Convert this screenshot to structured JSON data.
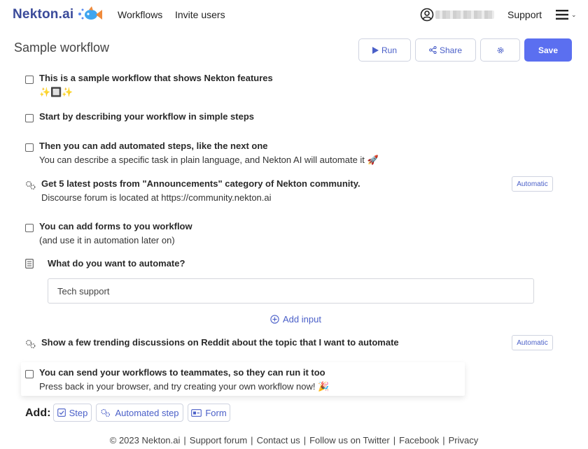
{
  "header": {
    "logo_text": "Nekton.ai",
    "nav": [
      "Workflows",
      "Invite users"
    ],
    "support": "Support"
  },
  "page": {
    "title": "Sample workflow"
  },
  "toolbar": {
    "run": "Run",
    "share": "Share",
    "save": "Save"
  },
  "steps": [
    {
      "type": "manual",
      "title": "This is a sample workflow that shows Nekton features",
      "sub": "✨🔲✨"
    },
    {
      "type": "manual",
      "title": "Start by describing your workflow in simple steps",
      "sub": ""
    },
    {
      "type": "manual",
      "title": "Then you can add automated steps, like the next one",
      "sub": "You can describe a specific task in plain language, and Nekton AI will automate it 🚀"
    },
    {
      "type": "automated",
      "title": "Get 5 latest posts from \"Announcements\" category of Nekton community.",
      "sub": "Discourse forum is located at https://community.nekton.ai",
      "badge": "Automatic"
    },
    {
      "type": "manual",
      "title": "You can add forms to you workflow",
      "sub": "(and use it in automation later on)"
    },
    {
      "type": "automated",
      "title": "Show a few trending discussions on Reddit about the topic that I want to automate",
      "sub": "",
      "badge": "Automatic"
    },
    {
      "type": "manual",
      "title": "You can send your workflows to teammates, so they can run it too",
      "sub": "Press back in your browser, and try creating your own workflow now! 🎉"
    }
  ],
  "form": {
    "question": "What do you want to automate?",
    "input_value": "Tech support",
    "add_input": "Add input"
  },
  "add_bar": {
    "label": "Add:",
    "step": "Step",
    "automated_step": "Automated step",
    "form": "Form"
  },
  "footer": [
    "© 2023 Nekton.ai",
    "Support forum",
    "Contact us",
    "Follow us on Twitter",
    "Facebook",
    "Privacy"
  ],
  "colors": {
    "accent": "#5b6ff0",
    "link": "#4a5fc8",
    "logo": "#3a4a9a"
  }
}
